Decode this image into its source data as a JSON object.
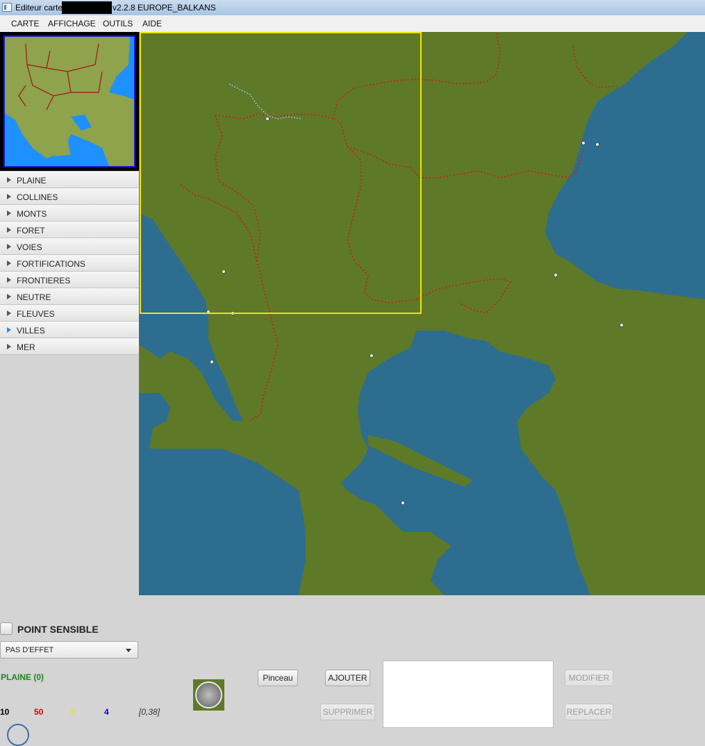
{
  "window": {
    "title_prefix": "Editeur carte",
    "title_suffix": "v2.2.8 EUROPE_BALKANS"
  },
  "menu": [
    "CARTE",
    "AFFICHAGE",
    "OUTILS",
    "AIDE"
  ],
  "categories": [
    {
      "label": "PLAINE",
      "selected": false
    },
    {
      "label": "COLLINES",
      "selected": false
    },
    {
      "label": "MONTS",
      "selected": false
    },
    {
      "label": "FORET",
      "selected": false
    },
    {
      "label": "VOIES",
      "selected": false
    },
    {
      "label": "FORTIFICATIONS",
      "selected": false
    },
    {
      "label": "FRONTIERES",
      "selected": false
    },
    {
      "label": "NEUTRE",
      "selected": false
    },
    {
      "label": "FLEUVES",
      "selected": false
    },
    {
      "label": "VILLES",
      "selected": true
    },
    {
      "label": "MER",
      "selected": false
    }
  ],
  "colors": {
    "land": "#5e7a28",
    "sea": "#2d6d8f",
    "border": "#c4231d",
    "viewport": "#f2e600",
    "minimap_land": "#8fa24c",
    "minimap_sea": "#1e90ff"
  },
  "point_sensible": {
    "label": "POINT SENSIBLE",
    "checked": false
  },
  "effect_select": {
    "value": "PAS D'EFFET"
  },
  "terrain_info": "PLAINE (0)",
  "stats": [
    {
      "value": "10",
      "color": "#000000"
    },
    {
      "value": "50",
      "color": "#e00000"
    },
    {
      "value": "0",
      "color": "#e8e800"
    },
    {
      "value": "4",
      "color": "#0000cc"
    }
  ],
  "coords": "[0,38]",
  "buttons": {
    "pinceau": "Pinceau",
    "ajouter": "AJOUTER",
    "supprimer": "SUPPRIMER",
    "modifier": "MODIFIER",
    "replacer": "REPLACER"
  },
  "tile_icon": "cobblestone-tile-icon"
}
